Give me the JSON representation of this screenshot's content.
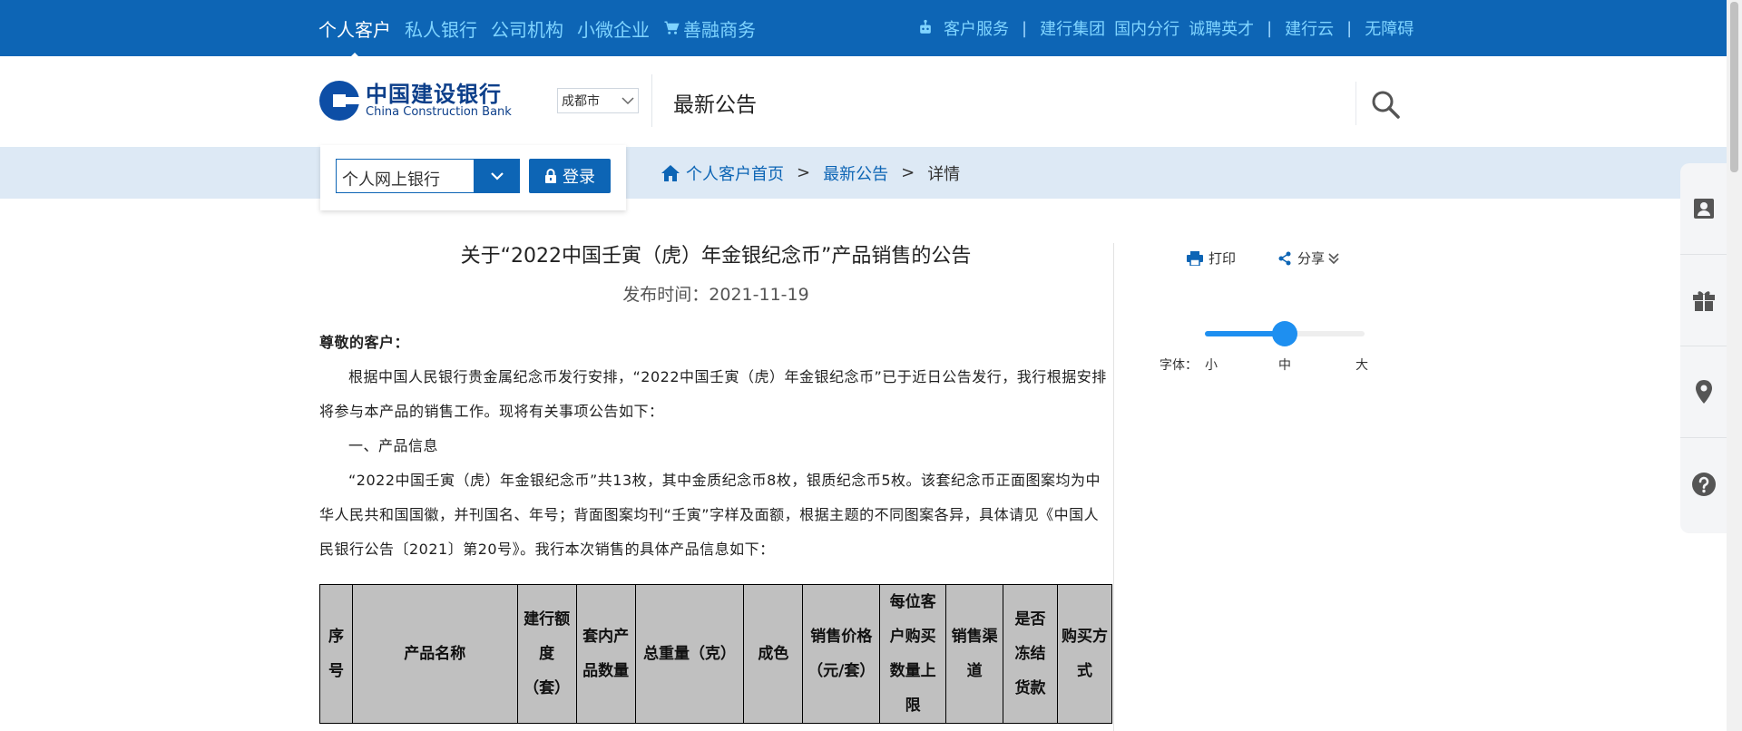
{
  "topbar": {
    "left_nav": [
      {
        "label": "个人客户",
        "active": true
      },
      {
        "label": "私人银行"
      },
      {
        "label": "公司机构"
      },
      {
        "label": "小微企业"
      },
      {
        "label": "善融商务",
        "icon": "cart-icon"
      }
    ],
    "right_nav": {
      "customer_service": "客户服务",
      "group": "建行集团",
      "domestic": "国内分行",
      "careers": "诚聘英才",
      "cloud": "建行云",
      "accessibility": "无障碍"
    },
    "colors": {
      "bar": "#0d65b5",
      "link": "#7fd4ff"
    }
  },
  "header": {
    "logo_cn": "中国建设银行",
    "logo_en": "China Construction Bank",
    "city": "成都市",
    "section_title": "最新公告"
  },
  "login": {
    "bank_type": "个人网上银行",
    "button": "登录"
  },
  "breadcrumb": {
    "home": "个人客户首页",
    "sep1": ">",
    "section": "最新公告",
    "sep2": ">",
    "current": "详情"
  },
  "article": {
    "title": "关于“2022中国壬寅（虎）年金银纪念币”产品销售的公告",
    "date": "发布时间：2021-11-19",
    "greeting": "尊敬的客户：",
    "para1": "根据中国人民银行贵金属纪念币发行安排，“2022中国壬寅（虎）年金银纪念币”已于近日公告发行，我行根据安排将参与本产品的销售工作。现将有关事项公告如下：",
    "section1": "一、产品信息",
    "para2": "“2022中国壬寅（虎）年金银纪念币”共13枚，其中金质纪念币8枚，银质纪念币5枚。该套纪念币正面图案均为中华人民共和国国徽，并刊国名、年号；背面图案均刊“壬寅”字样及面额，根据主题的不同图案各异，具体请见《中国人民银行公告〔2021〕第20号》。我行本次销售的具体产品信息如下："
  },
  "table": {
    "headers": [
      "序号",
      "产品名称",
      "建行额度（套）",
      "套内产品数量",
      "总重量（克）",
      "成色",
      "销售价格（元/套）",
      "每位客户购买数量上限",
      "销售渠道",
      "是否冻结货款",
      "购买方式"
    ]
  },
  "tools": {
    "print": "打印",
    "share": "分享",
    "font_label": "字体：",
    "font_small": "小",
    "font_medium": "中",
    "font_large": "大",
    "font_level": 0.5
  },
  "sidemenu": [
    "contact-card-icon",
    "gift-icon",
    "location-icon",
    "help-icon"
  ]
}
